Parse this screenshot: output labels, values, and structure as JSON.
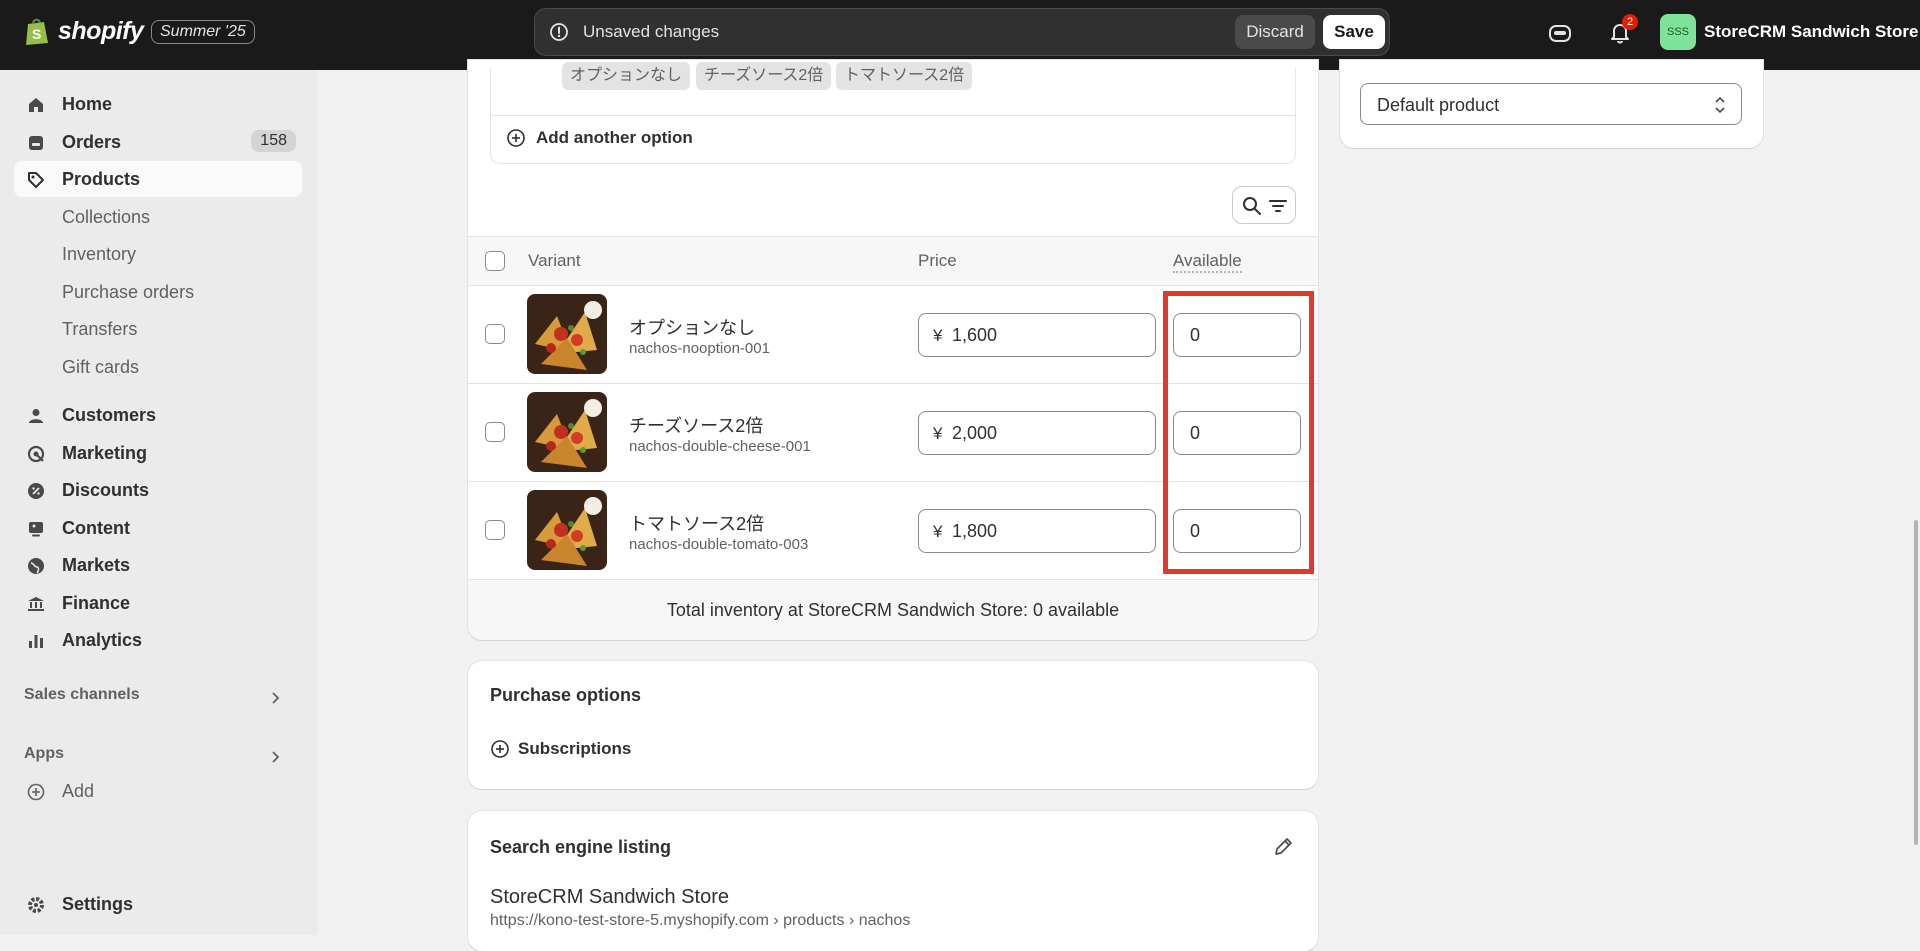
{
  "topbar": {
    "logo_text": "shopify",
    "badge": "Summer '25",
    "unsaved_text": "Unsaved changes",
    "discard_label": "Discard",
    "save_label": "Save",
    "notification_count": "2",
    "store_initials": "SSS",
    "store_name": "StoreCRM Sandwich Store"
  },
  "sidebar": {
    "items": [
      {
        "label": "Home",
        "icon": "home-icon"
      },
      {
        "label": "Orders",
        "icon": "orders-icon",
        "count": "158"
      },
      {
        "label": "Products",
        "icon": "tag-icon",
        "active": true
      },
      {
        "label": "Collections"
      },
      {
        "label": "Inventory"
      },
      {
        "label": "Purchase orders"
      },
      {
        "label": "Transfers"
      },
      {
        "label": "Gift cards"
      },
      {
        "label": "Customers",
        "icon": "person-icon"
      },
      {
        "label": "Marketing",
        "icon": "target-icon"
      },
      {
        "label": "Discounts",
        "icon": "discount-icon"
      },
      {
        "label": "Content",
        "icon": "content-icon"
      },
      {
        "label": "Markets",
        "icon": "globe-icon"
      },
      {
        "label": "Finance",
        "icon": "bank-icon"
      },
      {
        "label": "Analytics",
        "icon": "bar-chart-icon"
      }
    ],
    "sales_channels": "Sales channels",
    "apps": "Apps",
    "add": "Add",
    "settings": "Settings"
  },
  "options": {
    "tags": [
      "オプションなし",
      "チーズソース2倍",
      "トマトソース2倍"
    ],
    "add_another": "Add another option"
  },
  "variants": {
    "headers": {
      "variant": "Variant",
      "price": "Price",
      "available": "Available"
    },
    "currency": "¥",
    "rows": [
      {
        "name": "オプションなし",
        "sku": "nachos-nooption-001",
        "price": "1,600",
        "available": "0"
      },
      {
        "name": "チーズソース2倍",
        "sku": "nachos-double-cheese-001",
        "price": "2,000",
        "available": "0"
      },
      {
        "name": "トマトソース2倍",
        "sku": "nachos-double-tomato-003",
        "price": "1,800",
        "available": "0"
      }
    ],
    "total": "Total inventory at StoreCRM Sandwich Store: 0 available"
  },
  "purchase_options": {
    "title": "Purchase options",
    "subscriptions": "Subscriptions"
  },
  "seo": {
    "title": "Search engine listing",
    "store_title": "StoreCRM Sandwich Store",
    "url": "https://kono-test-store-5.myshopify.com › products › nachos"
  },
  "right_panel": {
    "select_value": "Default product"
  },
  "colors": {
    "highlight": "#e03a2b",
    "topbar": "#1a1a1a",
    "accent_green": "#7ee39a"
  }
}
